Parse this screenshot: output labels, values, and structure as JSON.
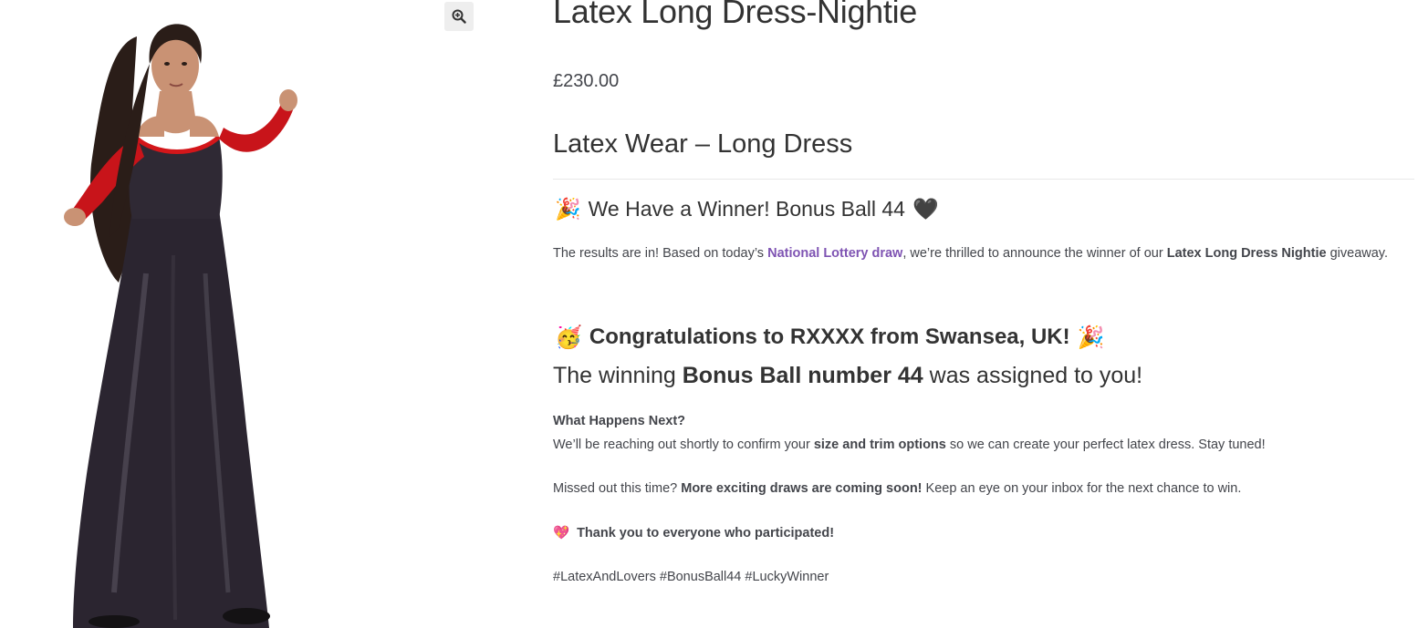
{
  "gallery": {
    "zoom_icon": "zoom-in-magnifier-icon"
  },
  "product": {
    "title": "Latex Long Dress-Nightie",
    "price": "£230.00",
    "short_heading": "Latex Wear – Long Dress"
  },
  "description": {
    "winner_heading": {
      "emoji_left": "🎉",
      "text": "We Have a Winner! Bonus Ball 44",
      "emoji_right": "🖤"
    },
    "results": {
      "prefix": "The results are in! Based on today’s ",
      "link": "National Lottery draw",
      "middle": ", we’re thrilled to announce the winner of our ",
      "product_bold": "Latex Long Dress Nightie",
      "suffix": " giveaway."
    },
    "congrats": {
      "emoji_left": "🥳",
      "text": "Congratulations to RXXXX from Swansea, UK!",
      "emoji_right": "🎉"
    },
    "winning_line": {
      "prefix": "The winning ",
      "bold": "Bonus Ball number 44",
      "suffix": " was assigned to you!"
    },
    "next": {
      "title": "What Happens Next?",
      "prefix": "We’ll be reaching out shortly to confirm your ",
      "bold": "size and trim options",
      "suffix": " so we can create your perfect latex dress. Stay tuned!"
    },
    "missed": {
      "prefix": "Missed out this time? ",
      "bold": "More exciting draws are coming soon!",
      "suffix": " Keep an eye on your inbox for the next chance to win."
    },
    "thanks": {
      "emoji": "💖",
      "text": "Thank you to everyone who participated!"
    },
    "hashtags": "#LatexAndLovers #BonusBall44 #LuckyWinner"
  },
  "colors": {
    "link": "#7f54b3",
    "body_text": "#43454b",
    "heading_text": "#333333"
  }
}
